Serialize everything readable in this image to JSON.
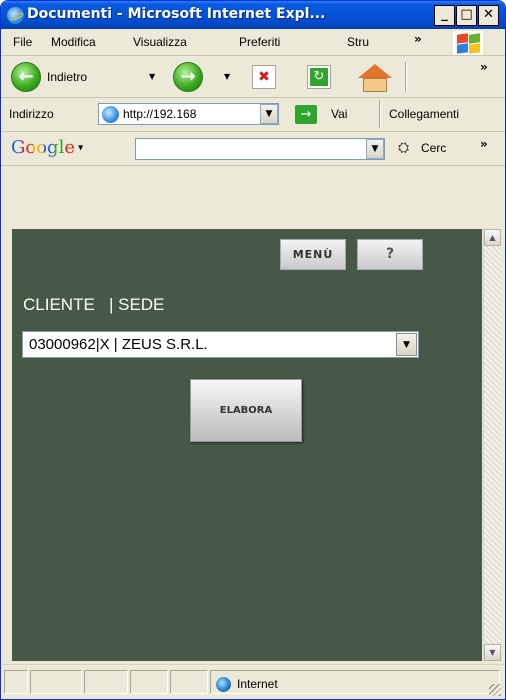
{
  "window": {
    "title": "Documenti - Microsoft Internet Expl...",
    "minimize_glyph": "_",
    "maximize_glyph": "□",
    "close_glyph": "✕"
  },
  "menu": {
    "items": [
      "File",
      "Modifica",
      "Visualizza",
      "Preferiti",
      "Stru"
    ],
    "overflow": "»"
  },
  "nav": {
    "back_label": "Indietro",
    "overflow": "»"
  },
  "address": {
    "label": "Indirizzo",
    "url": "http://192.168",
    "go_label": "Vai",
    "links_label": "Collegamenti"
  },
  "google": {
    "logo_text": "Google",
    "search_value": "",
    "search_button_label": "Cerc",
    "overflow": "»"
  },
  "page": {
    "menu_button_label": "MENÙ",
    "help_button_label": "?",
    "field_label": "CLIENTE   | SEDE",
    "select_value": "03000962|X | ZEUS S.R.L.",
    "elabora_label": "ELABORA",
    "background_color": "#465846"
  },
  "status": {
    "zone_label": "Internet"
  }
}
